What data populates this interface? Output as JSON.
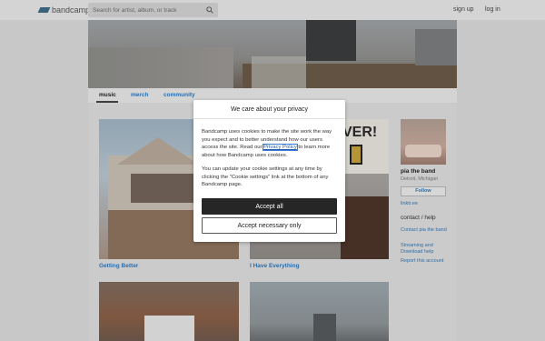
{
  "header": {
    "logo_text": "bandcamp",
    "search_placeholder": "Search for artist, album, or track",
    "signup": "sign up",
    "login": "log in"
  },
  "nav": {
    "music": "music",
    "merch": "merch",
    "community": "community",
    "active": "music"
  },
  "albums": [
    {
      "title": "Getting Better"
    },
    {
      "title": "I Have Everything"
    }
  ],
  "artist": {
    "name": "pia the band",
    "location": "Detroit, Michigan",
    "follow": "Follow",
    "website": "linktr.ee",
    "contact_heading": "contact / help",
    "contact_link": "Contact pia the band",
    "streaming_link": "Streaming and Download help",
    "report_link": "Report this account"
  },
  "dialog": {
    "title": "We care about your privacy",
    "p1_before": "Bandcamp uses cookies to make the site work the way you expect and to better understand how our users access the site. Read our ",
    "privacy_link": "Privacy Policy",
    "p1_after": " to learn more about how Bandcamp uses cookies.",
    "p2": "You can update your cookie settings at any time by clicking the \"Cookie settings\" link at the bottom of any Bandcamp page.",
    "accept_all": "Accept all",
    "accept_necessary": "Accept necessary only"
  },
  "art2_poster_text": "VER!"
}
